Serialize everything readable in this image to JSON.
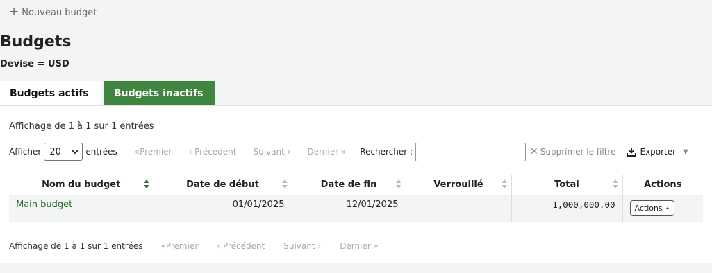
{
  "toolbar": {
    "new_budget": "Nouveau budget"
  },
  "page_title": "Budgets",
  "currency": "Devise = USD",
  "tabs": [
    {
      "label": "Budgets actifs",
      "active": true
    },
    {
      "label": "Budgets inactifs",
      "active": false
    }
  ],
  "info_text": "Affichage de 1 à 1 sur 1 entrées",
  "controls": {
    "show_label": "Afficher",
    "page_size": "20",
    "entries_label": "entrées",
    "first": "«Premier",
    "previous": "‹ Précédent",
    "next": "Suivant ›",
    "last": "Dernier »",
    "search_label": "Rechercher :",
    "search_value": "",
    "clear_filter": "Supprimer le filtre",
    "export": "Exporter"
  },
  "table": {
    "columns": [
      "Nom du budget",
      "Date de début",
      "Date de fin",
      "Verrouillé",
      "Total",
      "Actions"
    ],
    "rows": [
      {
        "name": "Main budget",
        "start": "01/01/2025",
        "end": "12/01/2025",
        "locked": "",
        "total": "1,000,000.00",
        "action": "Actions"
      }
    ]
  },
  "colors": {
    "accent": "#408540",
    "link": "#1b6b20"
  }
}
